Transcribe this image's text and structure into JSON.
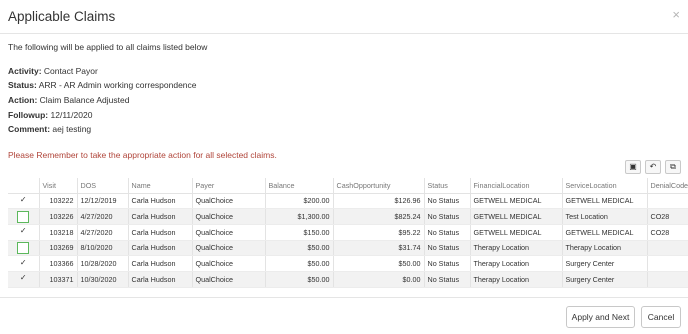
{
  "dialog": {
    "title": "Applicable Claims",
    "close_glyph": "×",
    "intro": "The following will be applied to all claims listed below",
    "details": [
      {
        "label": "Activity:",
        "value": "Contact Payor"
      },
      {
        "label": "Status:",
        "value": "ARR - AR Admin working correspondence"
      },
      {
        "label": "Action:",
        "value": "Claim Balance Adjusted"
      },
      {
        "label": "Followup:",
        "value": "12/11/2020"
      },
      {
        "label": "Comment:",
        "value": "aej testing"
      }
    ],
    "warning": "Please Remember to take the appropriate action for all selected claims.",
    "warning_color": "#b0453a"
  },
  "toolbar": {
    "buttons": [
      {
        "icon": "save-icon",
        "glyph": "▣"
      },
      {
        "icon": "undo-icon",
        "glyph": "↶"
      },
      {
        "icon": "copy-icon",
        "glyph": "⧉"
      }
    ]
  },
  "table": {
    "columns": [
      "",
      "Visit",
      "DOS",
      "Name",
      "Payer",
      "Balance",
      "CashOpportunity",
      "Status",
      "FinancialLocation",
      "ServiceLocation",
      "DenialCodes"
    ],
    "rows": [
      {
        "checked": true,
        "highlight": false,
        "nobox": true,
        "cells": [
          "103222",
          "12/12/2019",
          "Carla Hudson",
          "QualChoice",
          "$200.00",
          "$126.96",
          "No Status",
          "GETWELL MEDICAL",
          "GETWELL MEDICAL",
          ""
        ]
      },
      {
        "checked": false,
        "highlight": true,
        "nobox": false,
        "cells": [
          "103226",
          "4/27/2020",
          "Carla Hudson",
          "QualChoice",
          "$1,300.00",
          "$825.24",
          "No Status",
          "GETWELL MEDICAL",
          "Test Location",
          "CO28"
        ]
      },
      {
        "checked": true,
        "highlight": false,
        "nobox": true,
        "cells": [
          "103218",
          "4/27/2020",
          "Carla Hudson",
          "QualChoice",
          "$150.00",
          "$95.22",
          "No Status",
          "GETWELL MEDICAL",
          "GETWELL MEDICAL",
          "CO28"
        ]
      },
      {
        "checked": false,
        "highlight": true,
        "nobox": false,
        "cells": [
          "103269",
          "8/10/2020",
          "Carla Hudson",
          "QualChoice",
          "$50.00",
          "$31.74",
          "No Status",
          "Therapy Location",
          "Therapy Location",
          ""
        ]
      },
      {
        "checked": true,
        "highlight": false,
        "nobox": true,
        "cells": [
          "103366",
          "10/28/2020",
          "Carla Hudson",
          "QualChoice",
          "$50.00",
          "$50.00",
          "No Status",
          "Therapy Location",
          "Surgery Center",
          ""
        ]
      },
      {
        "checked": true,
        "highlight": false,
        "nobox": true,
        "cells": [
          "103371",
          "10/30/2020",
          "Carla Hudson",
          "QualChoice",
          "$50.00",
          "$0.00",
          "No Status",
          "Therapy Location",
          "Surgery Center",
          ""
        ]
      }
    ]
  },
  "footer": {
    "apply_label": "Apply and Next",
    "cancel_label": "Cancel"
  }
}
